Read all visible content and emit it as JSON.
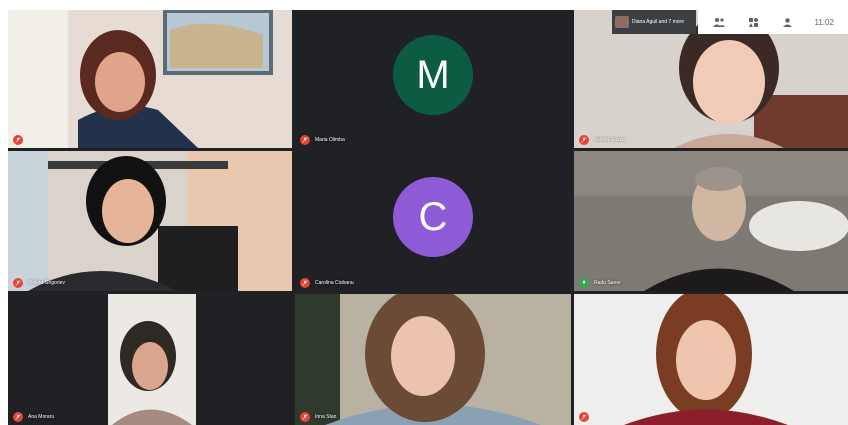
{
  "meeting": {
    "presenter_label": "Diana Aguil and 7 more",
    "time": "11:02"
  },
  "tiles": [
    {
      "name": "",
      "muted": true
    },
    {
      "name": "Maria Olimba",
      "initial": "M",
      "avatar_color": "#0b5c43",
      "muted": true
    },
    {
      "name": "Valeria Guzun",
      "muted": true
    },
    {
      "name": "Violeta Grigoriev",
      "muted": true
    },
    {
      "name": "Carolina Ciobanu",
      "initial": "C",
      "avatar_color": "#8e5bd6",
      "muted": true
    },
    {
      "name": "Radu Sarov",
      "muted": false
    },
    {
      "name": "Ana Moraru",
      "muted": true
    },
    {
      "name": "Irina Stan",
      "muted": true
    },
    {
      "name": "",
      "muted": true
    }
  ],
  "colors": {
    "grid_bg": "#202124",
    "mic_off": "#ea4335",
    "mic_on": "#34a853"
  }
}
